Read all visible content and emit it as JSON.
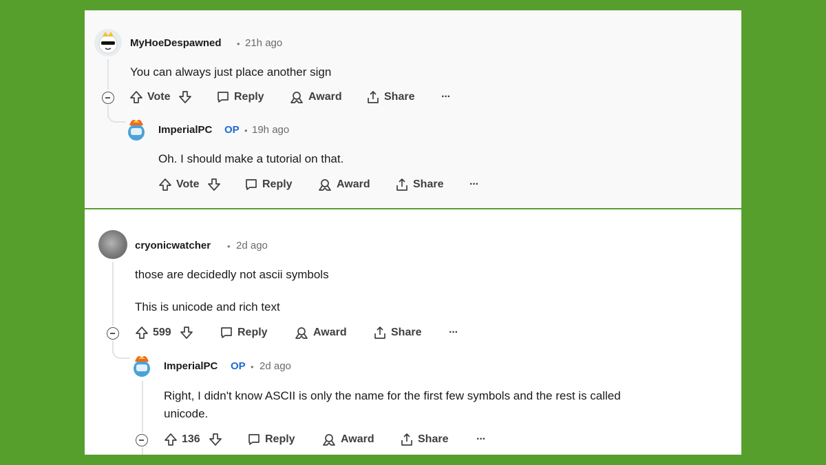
{
  "comments": [
    {
      "username": "MyHoeDespawned",
      "time": "21h ago",
      "text": "You can always just place another sign",
      "vote_label": "Vote",
      "reply": "Reply",
      "award": "Award",
      "share": "Share",
      "more": "···",
      "reply_item": {
        "username": "ImperialPC",
        "badge": "OP",
        "time": "19h ago",
        "text": "Oh. I should make a tutorial on that.",
        "vote_label": "Vote",
        "reply": "Reply",
        "award": "Award",
        "share": "Share",
        "more": "···"
      }
    },
    {
      "username": "cryonicwatcher",
      "time": "2d ago",
      "text_line1": "those are decidedly not ascii symbols",
      "text_line2": "This is unicode and rich text",
      "vote_label": "599",
      "reply": "Reply",
      "award": "Award",
      "share": "Share",
      "more": "···",
      "reply_item": {
        "username": "ImperialPC",
        "badge": "OP",
        "time": "2d ago",
        "text_line1": "Right, I didn't know ASCII is only the name for the first few symbols and the rest is called",
        "text_line2": "unicode.",
        "vote_label": "136",
        "reply": "Reply",
        "award": "Award",
        "share": "Share",
        "more": "···"
      }
    }
  ],
  "separator": "•",
  "colors": {
    "background": "#569f2d",
    "op_badge": "#1c6ad2"
  }
}
